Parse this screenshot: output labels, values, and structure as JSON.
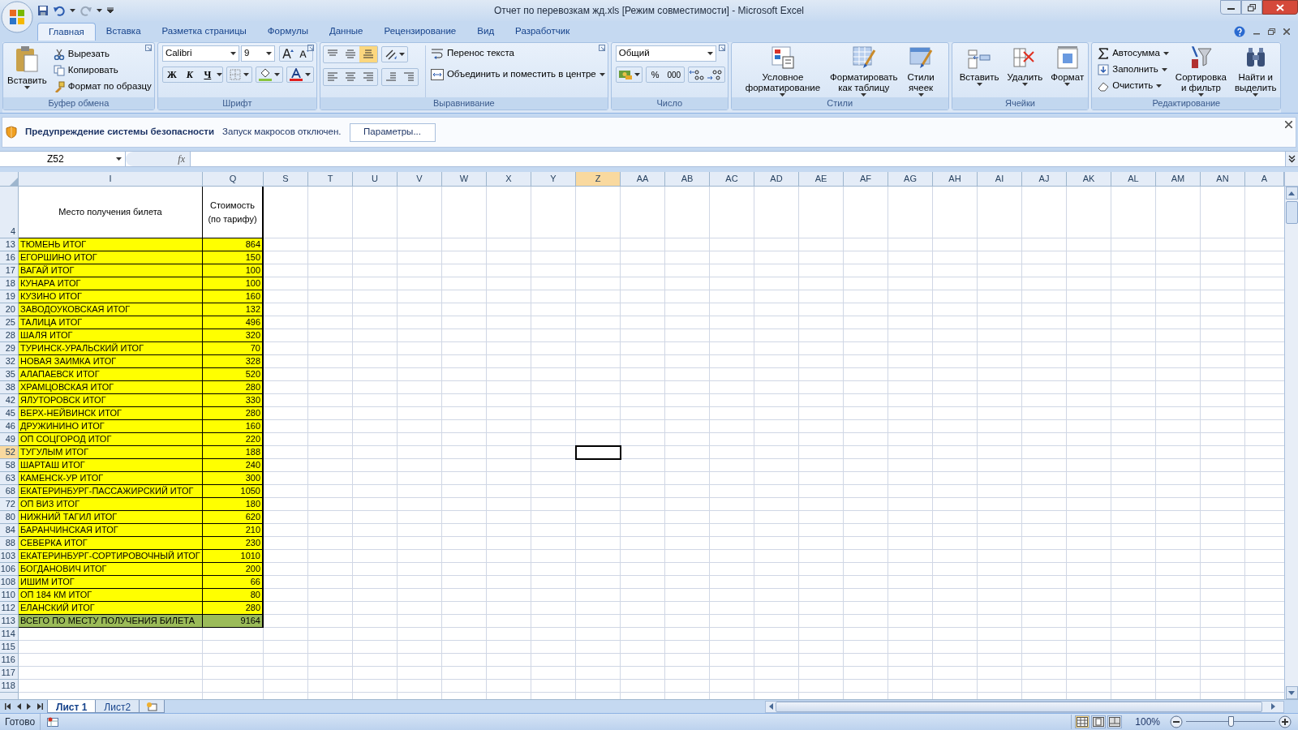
{
  "window": {
    "title": "Отчет по перевозкам жд.xls  [Режим совместимости] - Microsoft Excel"
  },
  "tabs": [
    {
      "label": "Главная",
      "selected": true
    },
    {
      "label": "Вставка",
      "selected": false
    },
    {
      "label": "Разметка страницы",
      "selected": false
    },
    {
      "label": "Формулы",
      "selected": false
    },
    {
      "label": "Данные",
      "selected": false
    },
    {
      "label": "Рецензирование",
      "selected": false
    },
    {
      "label": "Вид",
      "selected": false
    },
    {
      "label": "Разработчик",
      "selected": false
    }
  ],
  "ribbon": {
    "clipboard": {
      "label": "Буфер обмена",
      "paste": "Вставить",
      "items": [
        "Вырезать",
        "Копировать",
        "Формат по образцу"
      ]
    },
    "font": {
      "label": "Шрифт",
      "font_name": "Calibri",
      "font_size": "9",
      "bold": "Ж",
      "italic": "К",
      "underline": "Ч"
    },
    "alignment": {
      "label": "Выравнивание",
      "wrap": "Перенос текста",
      "merge": "Объединить и поместить в центре"
    },
    "number": {
      "label": "Число",
      "format": "Общий",
      "percent": "%",
      "thousands": "000"
    },
    "styles": {
      "label": "Стили",
      "buttons": [
        {
          "lines": [
            "Условное",
            "форматирование"
          ]
        },
        {
          "lines": [
            "Форматировать",
            "как таблицу"
          ]
        },
        {
          "lines": [
            "Стили",
            "ячеек"
          ]
        }
      ]
    },
    "cells": {
      "label": "Ячейки",
      "buttons": [
        "Вставить",
        "Удалить",
        "Формат"
      ]
    },
    "editing": {
      "label": "Редактирование",
      "items": [
        "Автосумма",
        "Заполнить",
        "Очистить"
      ],
      "buttons": [
        {
          "lines": [
            "Сортировка",
            "и фильтр"
          ]
        },
        {
          "lines": [
            "Найти и",
            "выделить"
          ]
        }
      ]
    }
  },
  "security_bar": {
    "title": "Предупреждение системы безопасности",
    "message": "Запуск макросов отключен.",
    "button": "Параметры..."
  },
  "formula_bar": {
    "name_box": "Z52",
    "function_button": "fx"
  },
  "sheet": {
    "columns": [
      {
        "label": "I",
        "selected": false
      },
      {
        "label": "Q",
        "selected": false
      },
      {
        "label": "S",
        "selected": false
      },
      {
        "label": "T",
        "selected": false
      },
      {
        "label": "U",
        "selected": false
      },
      {
        "label": "V",
        "selected": false
      },
      {
        "label": "W",
        "selected": false
      },
      {
        "label": "X",
        "selected": false
      },
      {
        "label": "Y",
        "selected": false
      },
      {
        "label": "Z",
        "selected": true
      },
      {
        "label": "AA",
        "selected": false
      },
      {
        "label": "AB",
        "selected": false
      },
      {
        "label": "AC",
        "selected": false
      },
      {
        "label": "AD",
        "selected": false
      },
      {
        "label": "AE",
        "selected": false
      },
      {
        "label": "AF",
        "selected": false
      },
      {
        "label": "AG",
        "selected": false
      },
      {
        "label": "AH",
        "selected": false
      },
      {
        "label": "AI",
        "selected": false
      },
      {
        "label": "AJ",
        "selected": false
      },
      {
        "label": "AK",
        "selected": false
      },
      {
        "label": "AL",
        "selected": false
      },
      {
        "label": "AM",
        "selected": false
      },
      {
        "label": "AN",
        "selected": false
      },
      {
        "label": "A",
        "selected": false
      }
    ],
    "rows": [
      {
        "number": "4",
        "kind": "header",
        "place": "Место получения билета",
        "cost": "Стоимость (по тарифу)",
        "selected": false
      },
      {
        "number": "13",
        "kind": "item",
        "place": "ТЮМЕНЬ ИТОГ",
        "cost": "864",
        "selected": false
      },
      {
        "number": "16",
        "kind": "item",
        "place": "ЕГОРШИНО ИТОГ",
        "cost": "150",
        "selected": false
      },
      {
        "number": "17",
        "kind": "item",
        "place": "ВАГАЙ ИТОГ",
        "cost": "100",
        "selected": false
      },
      {
        "number": "18",
        "kind": "item",
        "place": "КУНАРА ИТОГ",
        "cost": "100",
        "selected": false
      },
      {
        "number": "19",
        "kind": "item",
        "place": "КУЗИНО ИТОГ",
        "cost": "160",
        "selected": false
      },
      {
        "number": "20",
        "kind": "item",
        "place": "ЗАВОДОУКОВСКАЯ ИТОГ",
        "cost": "132",
        "selected": false
      },
      {
        "number": "25",
        "kind": "item",
        "place": "ТАЛИЦА ИТОГ",
        "cost": "496",
        "selected": false
      },
      {
        "number": "28",
        "kind": "item",
        "place": "ШАЛЯ ИТОГ",
        "cost": "320",
        "selected": false
      },
      {
        "number": "29",
        "kind": "item",
        "place": "ТУРИНСК-УРАЛЬСКИЙ ИТОГ",
        "cost": "70",
        "selected": false
      },
      {
        "number": "32",
        "kind": "item",
        "place": "НОВАЯ ЗАИМКА ИТОГ",
        "cost": "328",
        "selected": false
      },
      {
        "number": "35",
        "kind": "item",
        "place": "АЛАПАЕВСК ИТОГ",
        "cost": "520",
        "selected": false
      },
      {
        "number": "38",
        "kind": "item",
        "place": "ХРАМЦОВСКАЯ ИТОГ",
        "cost": "280",
        "selected": false
      },
      {
        "number": "42",
        "kind": "item",
        "place": "ЯЛУТОРОВСК ИТОГ",
        "cost": "330",
        "selected": false
      },
      {
        "number": "45",
        "kind": "item",
        "place": "ВЕРХ-НЕЙВИНСК ИТОГ",
        "cost": "280",
        "selected": false
      },
      {
        "number": "46",
        "kind": "item",
        "place": "ДРУЖИНИНО ИТОГ",
        "cost": "160",
        "selected": false
      },
      {
        "number": "49",
        "kind": "item",
        "place": "ОП СОЦГОРОД ИТОГ",
        "cost": "220",
        "selected": false
      },
      {
        "number": "52",
        "kind": "item",
        "place": "ТУГУЛЫМ ИТОГ",
        "cost": "188",
        "selected": true
      },
      {
        "number": "58",
        "kind": "item",
        "place": "ШАРТАШ ИТОГ",
        "cost": "240",
        "selected": false
      },
      {
        "number": "63",
        "kind": "item",
        "place": "КАМЕНСК-УР ИТОГ",
        "cost": "300",
        "selected": false
      },
      {
        "number": "68",
        "kind": "item",
        "place": "ЕКАТЕРИНБУРГ-ПАССАЖИРСКИЙ ИТОГ",
        "cost": "1050",
        "selected": false
      },
      {
        "number": "72",
        "kind": "item",
        "place": "ОП ВИЗ ИТОГ",
        "cost": "180",
        "selected": false
      },
      {
        "number": "80",
        "kind": "item",
        "place": "НИЖНИЙ ТАГИЛ ИТОГ",
        "cost": "620",
        "selected": false
      },
      {
        "number": "84",
        "kind": "item",
        "place": "БАРАНЧИНСКАЯ ИТОГ",
        "cost": "210",
        "selected": false
      },
      {
        "number": "88",
        "kind": "item",
        "place": "СЕВЕРКА ИТОГ",
        "cost": "230",
        "selected": false
      },
      {
        "number": "103",
        "kind": "item",
        "place": "ЕКАТЕРИНБУРГ-СОРТИРОВОЧНЫЙ ИТОГ",
        "cost": "1010",
        "selected": false
      },
      {
        "number": "106",
        "kind": "item",
        "place": "БОГДАНОВИЧ ИТОГ",
        "cost": "200",
        "selected": false
      },
      {
        "number": "108",
        "kind": "item",
        "place": "ИШИМ ИТОГ",
        "cost": "66",
        "selected": false
      },
      {
        "number": "110",
        "kind": "item",
        "place": "ОП 184 КМ ИТОГ",
        "cost": "80",
        "selected": false
      },
      {
        "number": "112",
        "kind": "item",
        "place": "ЕЛАНСКИЙ ИТОГ",
        "cost": "280",
        "selected": false
      },
      {
        "number": "113",
        "kind": "total",
        "place": "ВСЕГО ПО МЕСТУ ПОЛУЧЕНИЯ БИЛЕТА",
        "cost": "9164",
        "selected": false
      },
      {
        "number": "114",
        "kind": "empty",
        "selected": false
      },
      {
        "number": "115",
        "kind": "empty",
        "selected": false
      },
      {
        "number": "116",
        "kind": "empty",
        "selected": false
      },
      {
        "number": "117",
        "kind": "empty",
        "selected": false
      },
      {
        "number": "118",
        "kind": "empty",
        "selected": false
      }
    ]
  },
  "sheet_tabs": [
    {
      "label": "Лист 1",
      "selected": true
    },
    {
      "label": "Лист2",
      "selected": false
    }
  ],
  "status_bar": {
    "status": "Готово",
    "views": [
      {
        "selected": true
      },
      {
        "selected": false
      },
      {
        "selected": false
      }
    ],
    "zoom": "100%",
    "zoom_slider": {
      "level": 0.5
    }
  }
}
